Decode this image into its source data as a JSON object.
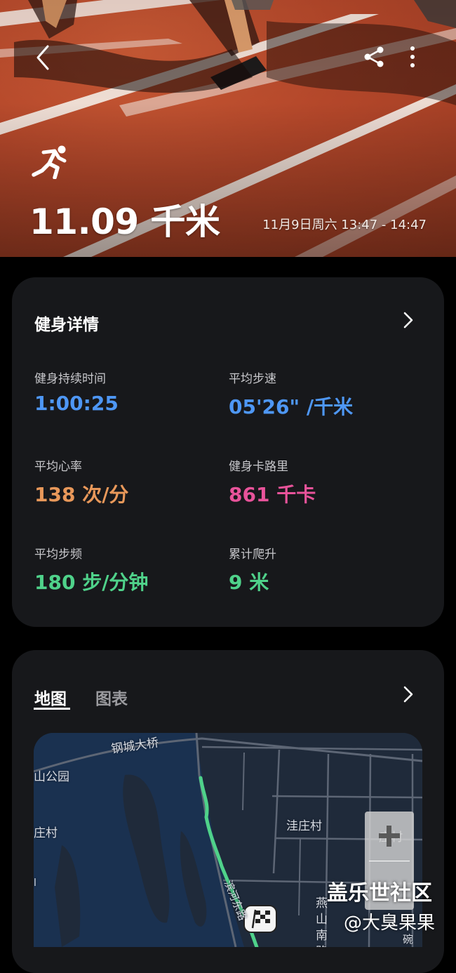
{
  "hero": {
    "distance": "11.09 千米",
    "timespan": "11月9日周六 13:47 - 14:47",
    "activity_icon": "running-person-icon",
    "background": "#b4472a"
  },
  "top_bar": {
    "back_icon": "chevron-left-icon",
    "share_icon": "share-icon",
    "more_icon": "more-vertical-icon"
  },
  "details": {
    "title": "健身详情",
    "stats": [
      {
        "label": "健身持续时间",
        "value": "1:00:25",
        "color": "#4e97f5"
      },
      {
        "label": "平均步速",
        "value": "05'26\" /千米",
        "color": "#4e97f5"
      },
      {
        "label": "平均心率",
        "value": "138 次/分",
        "color": "#e8985a"
      },
      {
        "label": "健身卡路里",
        "value": "861 千卡",
        "color": "#e8539a"
      },
      {
        "label": "平均步频",
        "value": "180 步/分钟",
        "color": "#4fd28a"
      },
      {
        "label": "累计爬升",
        "value": "9 米",
        "color": "#4fd28a"
      }
    ]
  },
  "map_card": {
    "tabs": [
      {
        "label": "地图",
        "active": true
      },
      {
        "label": "图表",
        "active": false
      }
    ],
    "map_labels": {
      "bridge": "钢城大桥",
      "park": "山公园",
      "village_left": "庄村",
      "village_mid": "洼庄村",
      "village_right": "庄村",
      "road_vertical": "燕山南路",
      "road_river": "滨河东路",
      "bottom_right": "碗",
      "far_left": "l"
    },
    "route_color": "#4fd28a",
    "zoom_in_icon": "plus-icon",
    "finish_icon": "checkered-flag-icon"
  },
  "watermark": {
    "line1": "盖乐世社区",
    "line2": "@大臭果果"
  }
}
